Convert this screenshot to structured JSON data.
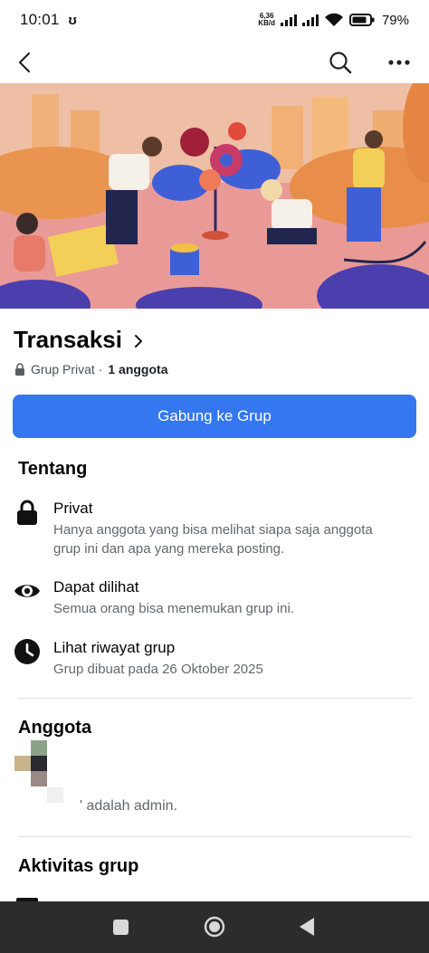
{
  "status_bar": {
    "time": "10:01",
    "app_icon": "ʊ",
    "net_speed_value": "6,36",
    "net_speed_unit": "KB/d",
    "battery": "79%"
  },
  "app_bar": {
    "back_icon": "back-arrow-icon",
    "search_icon": "search-icon",
    "more_icon": "more-options-icon"
  },
  "group": {
    "title": "Transaksi",
    "privacy_label": "Grup Privat ·",
    "member_count": "1 anggota",
    "join_button": "Gabung ke Grup"
  },
  "about": {
    "heading": "Tentang",
    "items": [
      {
        "icon": "lock-icon",
        "title": "Privat",
        "desc_line1": "Hanya anggota yang bisa melihat siapa saja anggota",
        "desc_line2": "grup ini dan apa yang mereka posting."
      },
      {
        "icon": "eye-icon",
        "title": "Dapat dilihat",
        "desc_line1": "Semua orang bisa menemukan grup ini."
      },
      {
        "icon": "clock-icon",
        "title": "Lihat riwayat grup",
        "desc_line1": "Grup dibuat pada 26 Oktober 2025"
      }
    ]
  },
  "members": {
    "heading": "Anggota",
    "admin_text": "' adalah admin."
  },
  "activity": {
    "heading": "Aktivitas grup"
  },
  "colors": {
    "accent": "#3577f0",
    "nav_bar": "#2c2c2c"
  }
}
